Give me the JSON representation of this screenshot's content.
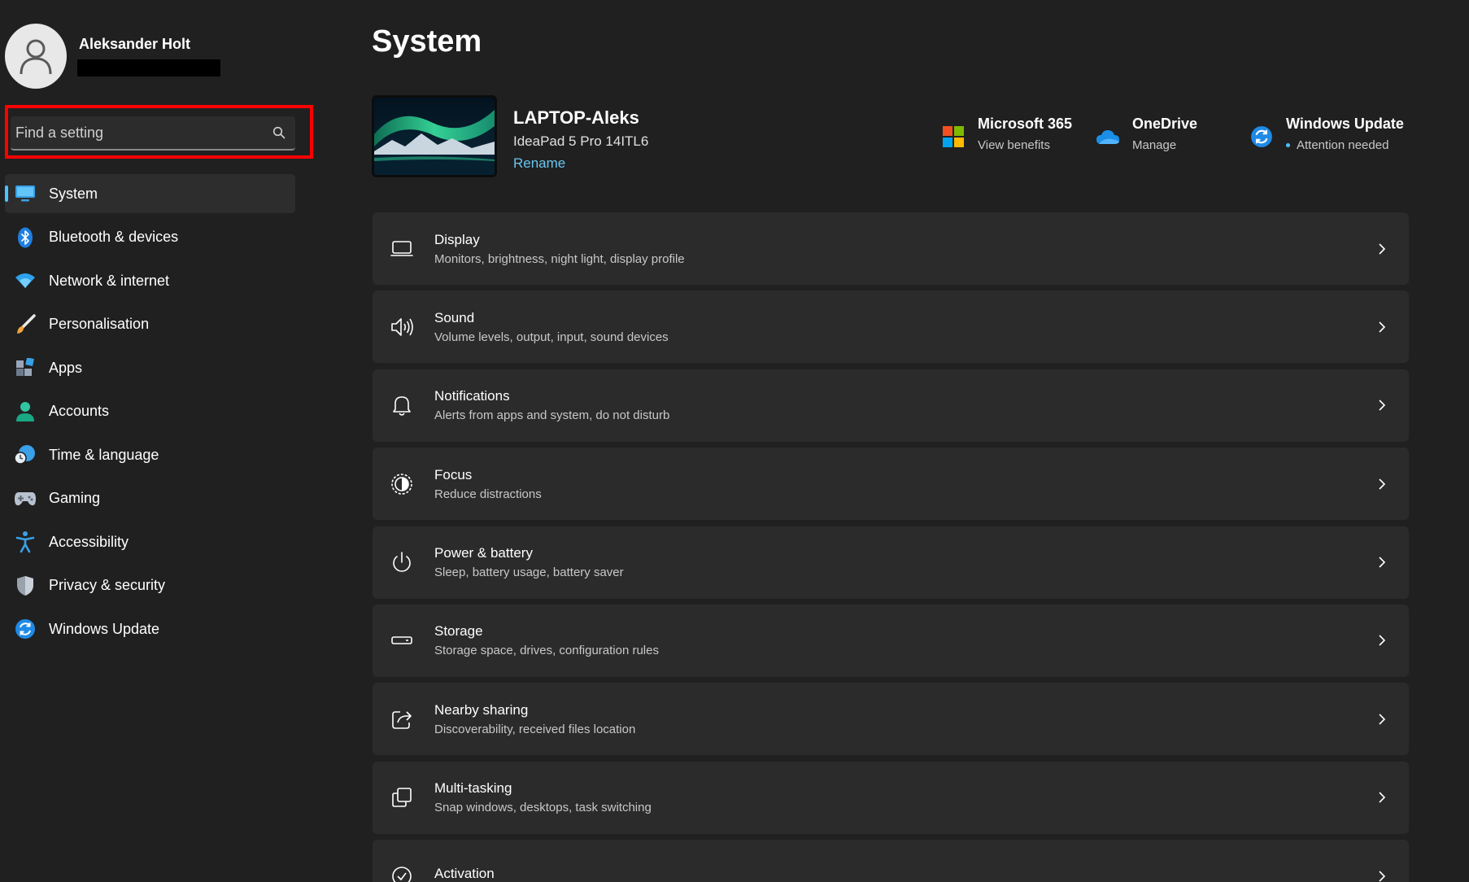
{
  "window": {
    "title": "System"
  },
  "user": {
    "name": "Aleksander Holt"
  },
  "search": {
    "placeholder": "Find a setting",
    "value": ""
  },
  "sidebar": {
    "items": [
      {
        "label": "System",
        "icon": "system-icon",
        "active": true
      },
      {
        "label": "Bluetooth & devices",
        "icon": "bluetooth-icon"
      },
      {
        "label": "Network & internet",
        "icon": "wifi-icon"
      },
      {
        "label": "Personalisation",
        "icon": "brush-icon"
      },
      {
        "label": "Apps",
        "icon": "apps-icon"
      },
      {
        "label": "Accounts",
        "icon": "accounts-icon"
      },
      {
        "label": "Time & language",
        "icon": "clock-globe-icon"
      },
      {
        "label": "Gaming",
        "icon": "gamepad-icon"
      },
      {
        "label": "Accessibility",
        "icon": "accessibility-icon"
      },
      {
        "label": "Privacy & security",
        "icon": "shield-icon"
      },
      {
        "label": "Windows Update",
        "icon": "windows-update-icon"
      }
    ]
  },
  "device": {
    "name": "LAPTOP-Aleks",
    "model": "IdeaPad 5 Pro 14ITL6",
    "rename_label": "Rename"
  },
  "quick_links": [
    {
      "title": "Microsoft 365",
      "subtitle": "View benefits",
      "icon": "microsoft-logo-icon"
    },
    {
      "title": "OneDrive",
      "subtitle": "Manage",
      "icon": "onedrive-cloud-icon"
    },
    {
      "title": "Windows Update",
      "subtitle": "Attention needed",
      "icon": "windows-update-icon"
    }
  ],
  "settings": [
    {
      "title": "Display",
      "subtitle": "Monitors, brightness, night light, display profile",
      "icon": "display-icon"
    },
    {
      "title": "Sound",
      "subtitle": "Volume levels, output, input, sound devices",
      "icon": "speaker-icon"
    },
    {
      "title": "Notifications",
      "subtitle": "Alerts from apps and system, do not disturb",
      "icon": "bell-icon"
    },
    {
      "title": "Focus",
      "subtitle": "Reduce distractions",
      "icon": "focus-icon"
    },
    {
      "title": "Power & battery",
      "subtitle": "Sleep, battery usage, battery saver",
      "icon": "power-icon"
    },
    {
      "title": "Storage",
      "subtitle": "Storage space, drives, configuration rules",
      "icon": "storage-icon"
    },
    {
      "title": "Nearby sharing",
      "subtitle": "Discoverability, received files location",
      "icon": "share-icon"
    },
    {
      "title": "Multi-tasking",
      "subtitle": "Snap windows, desktops, task switching",
      "icon": "multitasking-icon"
    },
    {
      "title": "Activation",
      "subtitle": "",
      "icon": "activation-check-icon"
    }
  ],
  "colors": {
    "accent": "#4cc2ff",
    "link": "#68c6f0",
    "highlight_box": "#ff0000",
    "background": "#202020",
    "card": "#2b2b2b"
  }
}
